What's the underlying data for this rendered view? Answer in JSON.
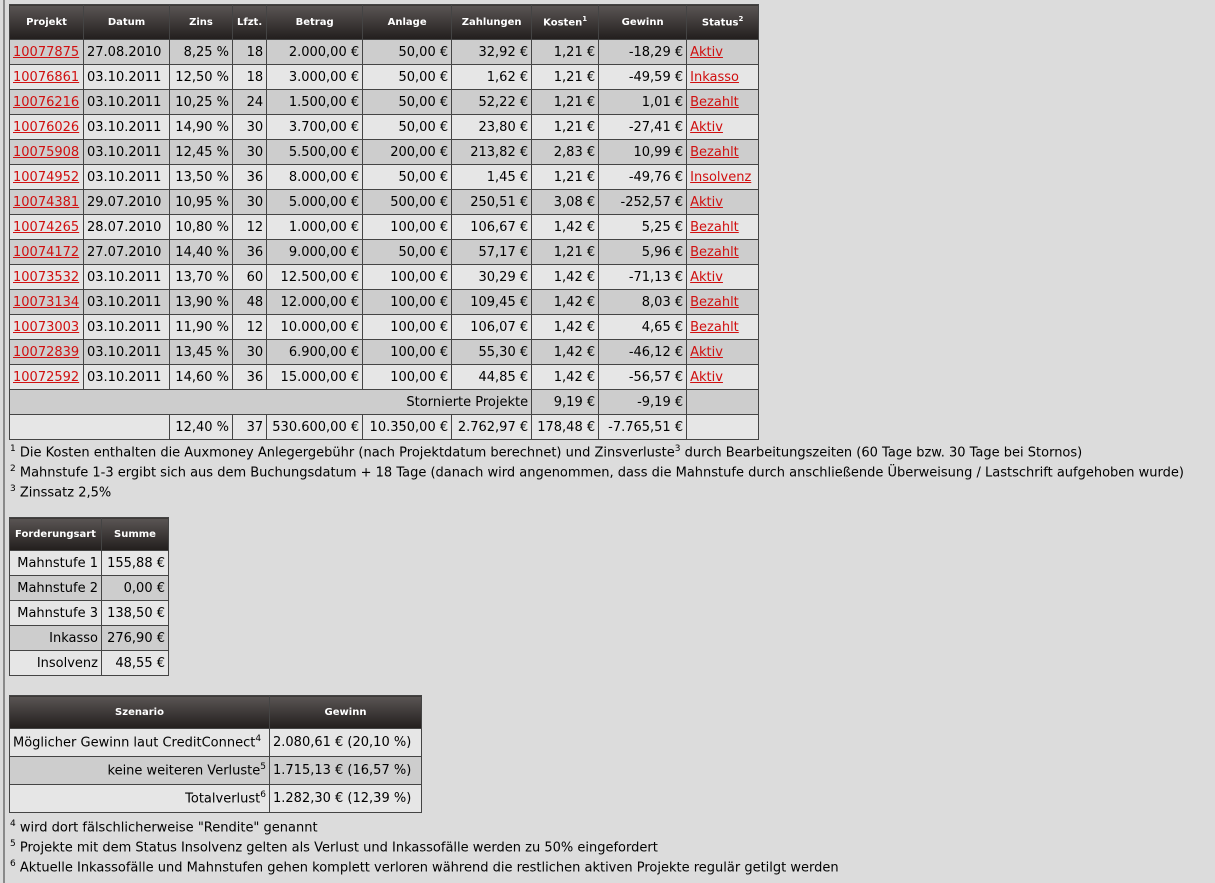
{
  "main": {
    "headers": [
      "Projekt",
      "Datum",
      "Zins",
      "Lfzt.",
      "Betrag",
      "Anlage",
      "Zahlungen",
      "Kosten",
      "Gewinn",
      "Status"
    ],
    "kosten_sup": "1",
    "status_sup": "2",
    "rows": [
      {
        "id": "10077875",
        "datum": "27.08.2010",
        "zins": "8,25 %",
        "lfzt": "18",
        "betrag": "2.000,00 €",
        "anlage": "50,00 €",
        "zahlungen": "32,92 €",
        "kosten": "1,21 €",
        "gewinn": "-18,29 €",
        "status": "Aktiv"
      },
      {
        "id": "10076861",
        "datum": "03.10.2011",
        "zins": "12,50 %",
        "lfzt": "18",
        "betrag": "3.000,00 €",
        "anlage": "50,00 €",
        "zahlungen": "1,62 €",
        "kosten": "1,21 €",
        "gewinn": "-49,59 €",
        "status": "Inkasso"
      },
      {
        "id": "10076216",
        "datum": "03.10.2011",
        "zins": "10,25 %",
        "lfzt": "24",
        "betrag": "1.500,00 €",
        "anlage": "50,00 €",
        "zahlungen": "52,22 €",
        "kosten": "1,21 €",
        "gewinn": "1,01 €",
        "status": "Bezahlt"
      },
      {
        "id": "10076026",
        "datum": "03.10.2011",
        "zins": "14,90 %",
        "lfzt": "30",
        "betrag": "3.700,00 €",
        "anlage": "50,00 €",
        "zahlungen": "23,80 €",
        "kosten": "1,21 €",
        "gewinn": "-27,41 €",
        "status": "Aktiv"
      },
      {
        "id": "10075908",
        "datum": "03.10.2011",
        "zins": "12,45 %",
        "lfzt": "30",
        "betrag": "5.500,00 €",
        "anlage": "200,00 €",
        "zahlungen": "213,82 €",
        "kosten": "2,83 €",
        "gewinn": "10,99 €",
        "status": "Bezahlt"
      },
      {
        "id": "10074952",
        "datum": "03.10.2011",
        "zins": "13,50 %",
        "lfzt": "36",
        "betrag": "8.000,00 €",
        "anlage": "50,00 €",
        "zahlungen": "1,45 €",
        "kosten": "1,21 €",
        "gewinn": "-49,76 €",
        "status": "Insolvenz"
      },
      {
        "id": "10074381",
        "datum": "29.07.2010",
        "zins": "10,95 %",
        "lfzt": "30",
        "betrag": "5.000,00 €",
        "anlage": "500,00 €",
        "zahlungen": "250,51 €",
        "kosten": "3,08 €",
        "gewinn": "-252,57 €",
        "status": "Aktiv"
      },
      {
        "id": "10074265",
        "datum": "28.07.2010",
        "zins": "10,80 %",
        "lfzt": "12",
        "betrag": "1.000,00 €",
        "anlage": "100,00 €",
        "zahlungen": "106,67 €",
        "kosten": "1,42 €",
        "gewinn": "5,25 €",
        "status": "Bezahlt"
      },
      {
        "id": "10074172",
        "datum": "27.07.2010",
        "zins": "14,40 %",
        "lfzt": "36",
        "betrag": "9.000,00 €",
        "anlage": "50,00 €",
        "zahlungen": "57,17 €",
        "kosten": "1,21 €",
        "gewinn": "5,96 €",
        "status": "Bezahlt"
      },
      {
        "id": "10073532",
        "datum": "03.10.2011",
        "zins": "13,70 %",
        "lfzt": "60",
        "betrag": "12.500,00 €",
        "anlage": "100,00 €",
        "zahlungen": "30,29 €",
        "kosten": "1,42 €",
        "gewinn": "-71,13 €",
        "status": "Aktiv"
      },
      {
        "id": "10073134",
        "datum": "03.10.2011",
        "zins": "13,90 %",
        "lfzt": "48",
        "betrag": "12.000,00 €",
        "anlage": "100,00 €",
        "zahlungen": "109,45 €",
        "kosten": "1,42 €",
        "gewinn": "8,03 €",
        "status": "Bezahlt"
      },
      {
        "id": "10073003",
        "datum": "03.10.2011",
        "zins": "11,90 %",
        "lfzt": "12",
        "betrag": "10.000,00 €",
        "anlage": "100,00 €",
        "zahlungen": "106,07 €",
        "kosten": "1,42 €",
        "gewinn": "4,65 €",
        "status": "Bezahlt"
      },
      {
        "id": "10072839",
        "datum": "03.10.2011",
        "zins": "13,45 %",
        "lfzt": "30",
        "betrag": "6.900,00 €",
        "anlage": "100,00 €",
        "zahlungen": "55,30 €",
        "kosten": "1,42 €",
        "gewinn": "-46,12 €",
        "status": "Aktiv"
      },
      {
        "id": "10072592",
        "datum": "03.10.2011",
        "zins": "14,60 %",
        "lfzt": "36",
        "betrag": "15.000,00 €",
        "anlage": "100,00 €",
        "zahlungen": "44,85 €",
        "kosten": "1,42 €",
        "gewinn": "-56,57 €",
        "status": "Aktiv"
      }
    ],
    "storniert": {
      "label": "Stornierte Projekte",
      "kosten": "9,19 €",
      "gewinn": "-9,19 €"
    },
    "total": {
      "zins": "12,40 %",
      "lfzt": "37",
      "betrag": "530.600,00 €",
      "anlage": "10.350,00 €",
      "zahlungen": "2.762,97 €",
      "kosten": "178,48 €",
      "gewinn": "-7.765,51 €"
    }
  },
  "notes1": [
    {
      "sup": "1",
      "pre": "Die Kosten enthalten die Auxmoney Anlegergebühr (nach Projektdatum berechnet) und Zinsverluste",
      "sup2": "3",
      "post": " durch Bearbeitungszeiten (60 Tage bzw. 30 Tage bei Stornos)"
    },
    {
      "sup": "2",
      "text": "Mahnstufe 1-3 ergibt sich aus dem Buchungsdatum + 18 Tage (danach wird angenommen, dass die Mahnstufe durch anschließende Überweisung / Lastschrift aufgehoben wurde)"
    },
    {
      "sup": "3",
      "text": "Zinssatz 2,5%"
    }
  ],
  "forderung": {
    "headers": [
      "Forderungsart",
      "Summe"
    ],
    "rows": [
      {
        "art": "Mahnstufe 1",
        "summe": "155,88 €"
      },
      {
        "art": "Mahnstufe 2",
        "summe": "0,00 €"
      },
      {
        "art": "Mahnstufe 3",
        "summe": "138,50 €"
      },
      {
        "art": "Inkasso",
        "summe": "276,90 €"
      },
      {
        "art": "Insolvenz",
        "summe": "48,55 €"
      }
    ]
  },
  "szenario": {
    "headers": [
      "Szenario",
      "Gewinn"
    ],
    "rows": [
      {
        "label": "Möglicher Gewinn laut CreditConnect",
        "sup": "4",
        "gewinn": "2.080,61 € (20,10 %)"
      },
      {
        "label": "keine weiteren Verluste",
        "sup": "5",
        "gewinn": "1.715,13 € (16,57 %)"
      },
      {
        "label": "Totalverlust",
        "sup": "6",
        "gewinn": "1.282,30 € (12,39 %)"
      }
    ]
  },
  "notes2": [
    {
      "sup": "4",
      "text": "wird dort fälschlicherweise \"Rendite\" genannt"
    },
    {
      "sup": "5",
      "text": "Projekte mit dem Status Insolvenz gelten als Verlust und Inkassofälle werden zu 50% eingefordert"
    },
    {
      "sup": "6",
      "text": "Aktuelle Inkassofälle und Mahnstufen gehen komplett verloren während die restlichen aktiven Projekte regulär getilgt werden"
    }
  ]
}
